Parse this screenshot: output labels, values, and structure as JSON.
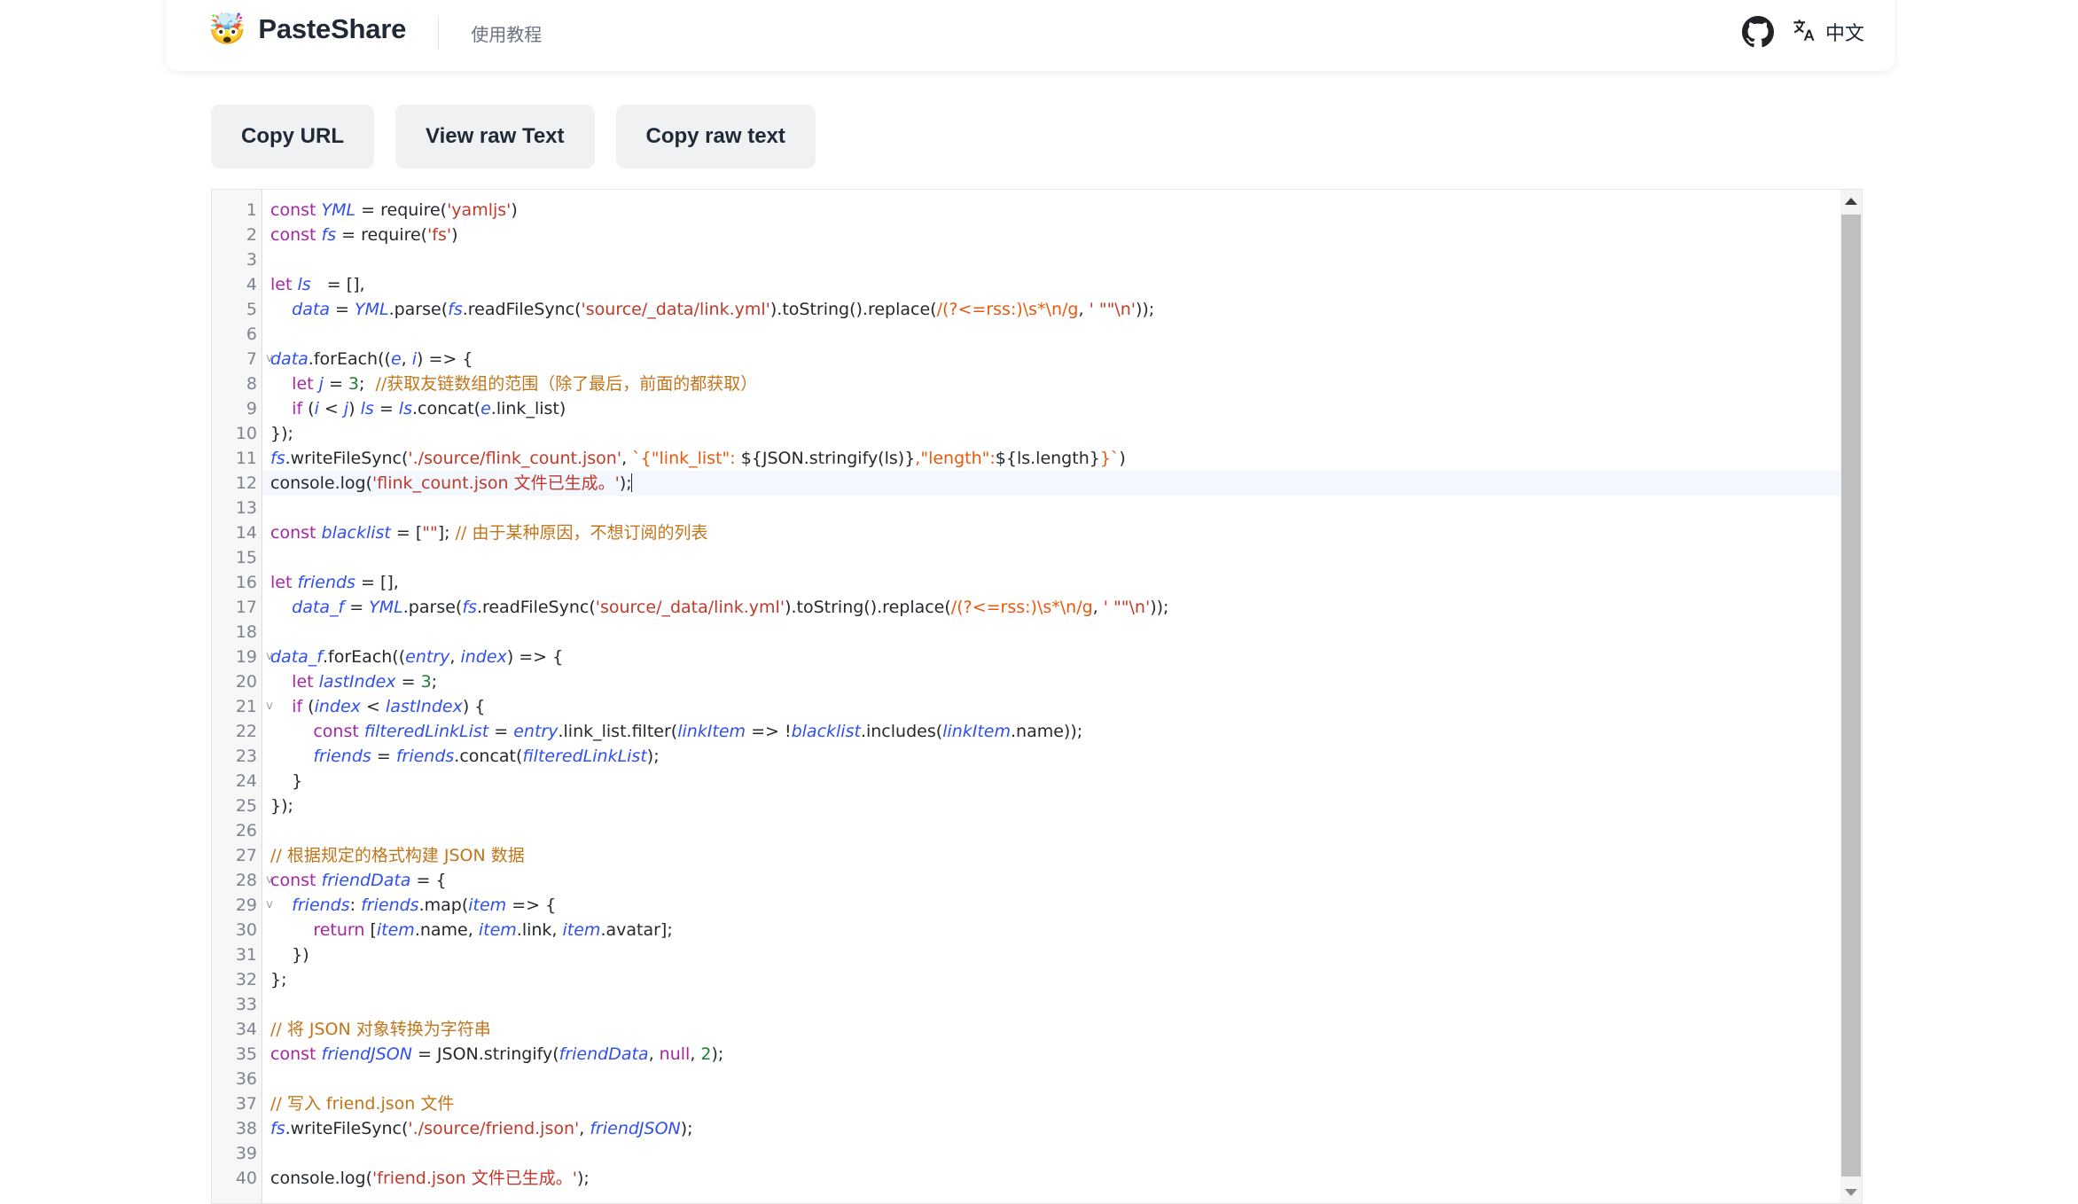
{
  "header": {
    "brand_emoji": "🤯",
    "brand_name": "PasteShare",
    "nav_link": "使用教程",
    "github_icon": "github-icon",
    "language_icon": "translate-icon",
    "language_label": "中文"
  },
  "toolbar": {
    "copy_url_label": "Copy URL",
    "view_raw_label": "View raw Text",
    "copy_raw_label": "Copy raw text"
  },
  "editor": {
    "active_line": 12,
    "total_lines": 40,
    "fold_lines": [
      7,
      19,
      21,
      28,
      29
    ],
    "line_numbers": [
      1,
      2,
      3,
      4,
      5,
      6,
      7,
      8,
      9,
      10,
      11,
      12,
      13,
      14,
      15,
      16,
      17,
      18,
      19,
      20,
      21,
      22,
      23,
      24,
      25,
      26,
      27,
      28,
      29,
      30,
      31,
      32,
      33,
      34,
      35,
      36,
      37,
      38,
      39,
      40
    ],
    "lines": [
      "const YML = require('yamljs')",
      "const fs = require('fs')",
      "",
      "let ls   = [],",
      "    data = YML.parse(fs.readFileSync('source/_data/link.yml').toString().replace(/(?<=rss:)\\s*\\n/g, ' \"\"\\n'));",
      "",
      "data.forEach((e, i) => {",
      "    let j = 3;  //获取友链数组的范围（除了最后，前面的都获取）",
      "    if (i < j) ls = ls.concat(e.link_list)",
      "});",
      "fs.writeFileSync('./source/flink_count.json', `{\"link_list\": ${JSON.stringify(ls)},\"length\":${ls.length}}`)",
      "console.log('flink_count.json 文件已生成。');",
      "",
      "const blacklist = [\"\"]; // 由于某种原因，不想订阅的列表",
      "",
      "let friends = [],",
      "    data_f = YML.parse(fs.readFileSync('source/_data/link.yml').toString().replace(/(?<=rss:)\\s*\\n/g, ' \"\"\\n'));",
      "",
      "data_f.forEach((entry, index) => {",
      "    let lastIndex = 3;",
      "    if (index < lastIndex) {",
      "        const filteredLinkList = entry.link_list.filter(linkItem => !blacklist.includes(linkItem.name));",
      "        friends = friends.concat(filteredLinkList);",
      "    }",
      "});",
      "",
      "// 根据规定的格式构建 JSON 数据",
      "const friendData = {",
      "    friends: friends.map(item => {",
      "        return [item.name, item.link, item.avatar];",
      "    })",
      "};",
      "",
      "// 将 JSON 对象转换为字符串",
      "const friendJSON = JSON.stringify(friendData, null, 2);",
      "",
      "// 写入 friend.json 文件",
      "fs.writeFileSync('./source/friend.json', friendJSON);",
      "",
      "console.log('friend.json 文件已生成。');"
    ]
  },
  "scrollbar": {
    "up_arrow": "scroll-up-arrow",
    "down_arrow": "scroll-down-arrow"
  },
  "colors": {
    "keyword": "#a626a4",
    "variable": "#2f4ff0",
    "string": "#c0392b",
    "regex": "#e8590c",
    "comment": "#c2751a",
    "number": "#1a7f37",
    "button_bg": "#f0f1f3",
    "active_line": "#f2f8fd",
    "gutter_bg": "#f7f7f7"
  }
}
